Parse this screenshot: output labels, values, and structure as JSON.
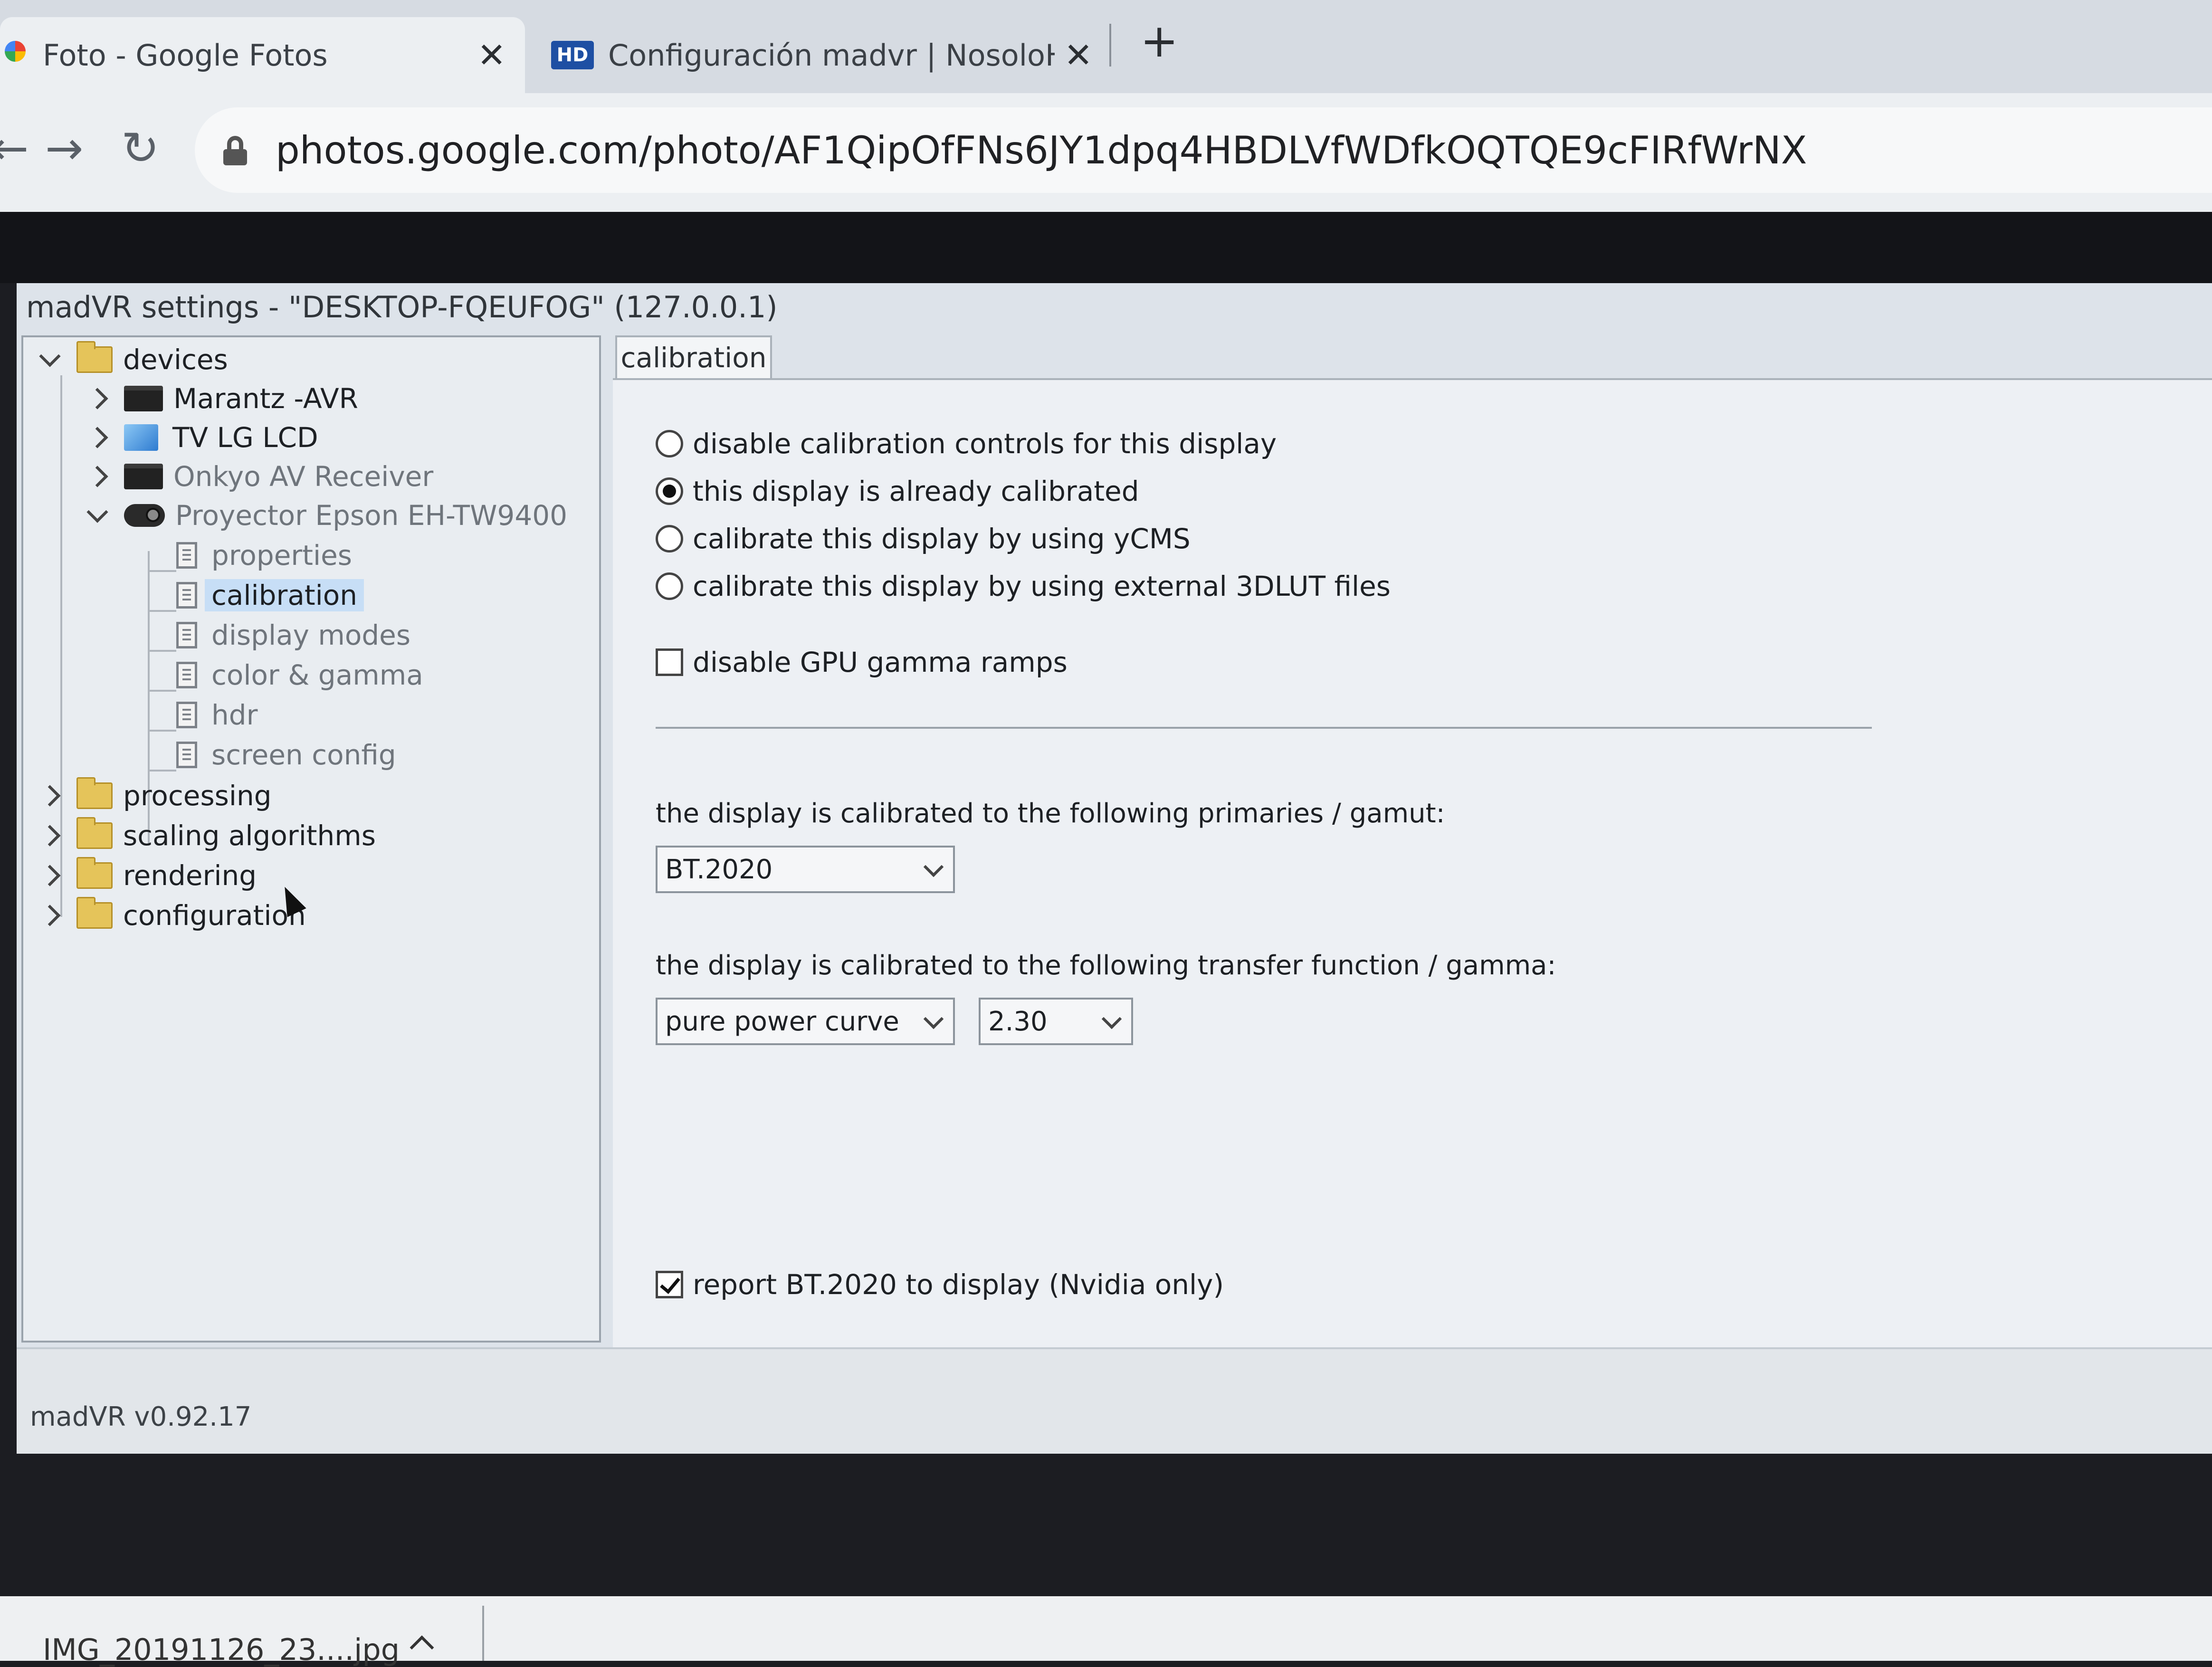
{
  "browser": {
    "tabs": [
      {
        "title": "Foto - Google Fotos",
        "close": "✕"
      },
      {
        "title": "Configuración madvr | NosoloHD",
        "close": "✕",
        "favicon_text": "HD"
      }
    ],
    "new_tab": "+",
    "nav": {
      "back": "←",
      "forward": "→",
      "reload": "↻"
    },
    "url": "photos.google.com/photo/AF1QipOfFNs6JY1dpq4HBDLVfWDfkOQTQE9cFIRfWrNX"
  },
  "window": {
    "title": "madVR settings - \"DESKTOP-FQEUFOG\" (127.0.0.1)",
    "version": "madVR v0.92.17"
  },
  "tree": {
    "devices": "devices",
    "marantz": "Marantz -AVR",
    "tv": "TV LG LCD",
    "onkyo": "Onkyo AV Receiver",
    "projector": "Proyector Epson EH-TW9400",
    "properties": "properties",
    "calibration": "calibration",
    "display_modes": "display modes",
    "color_gamma": "color & gamma",
    "hdr": "hdr",
    "screen_config": "screen config",
    "processing": "processing",
    "scaling": "scaling algorithms",
    "rendering": "rendering",
    "configuration": "configuration"
  },
  "panel": {
    "tab": "calibration",
    "radio_disable": "disable calibration controls for this display",
    "radio_already": "this display is already calibrated",
    "radio_ycms": "calibrate this display by using yCMS",
    "radio_3dlut": "calibrate this display by using external 3DLUT files",
    "check_gpu": "disable GPU gamma ramps",
    "primaries_label": "the display is calibrated to the following primaries / gamut:",
    "primaries_value": "BT.2020",
    "transfer_label": "the display is calibrated to the following transfer function / gamma:",
    "transfer_value": "pure power curve",
    "gamma_value": "2.30",
    "check_report": "report BT.2020 to display  (Nvidia only)",
    "selected_radio": "radio_already",
    "check_gpu_checked": false,
    "check_report_checked": true
  },
  "download": {
    "file": "IMG_20191126_23....jpg"
  },
  "colors": {
    "selection": "#c7def6",
    "folder": "#e5c45a"
  }
}
